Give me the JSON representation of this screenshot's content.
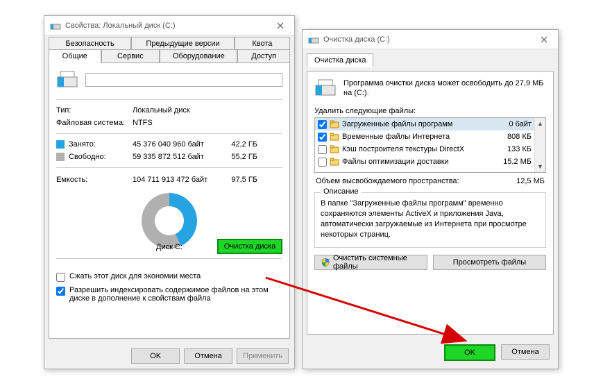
{
  "props": {
    "title": "Свойства: Локальный диск (C:)",
    "tabs_top": [
      "Безопасность",
      "Предыдущие версии",
      "Квота"
    ],
    "tabs_bot": [
      "Общие",
      "Сервис",
      "Оборудование",
      "Доступ"
    ],
    "name_value": "",
    "type_label": "Тип:",
    "type_value": "Локальный диск",
    "fs_label": "Файловая система:",
    "fs_value": "NTFS",
    "used_label": "Занято:",
    "used_bytes": "45 376 040 960 байт",
    "used_gb": "42,2 ГБ",
    "free_label": "Свободно:",
    "free_bytes": "59 335 872 512 байт",
    "free_gb": "55,2 ГБ",
    "cap_label": "Емкость:",
    "cap_bytes": "104 711 913 472 байт",
    "cap_gb": "97,5 ГБ",
    "disk_label": "Диск C:",
    "clean_btn": "Очистка диска",
    "compress_label": "Сжать этот диск для экономии места",
    "index_label": "Разрешить индексировать содержимое файлов на этом диске в дополнение к свойствам файла",
    "ok": "OK",
    "cancel": "Отмена",
    "apply": "Применить"
  },
  "cleanup": {
    "title": "Очистка диска  (C:)",
    "tab": "Очистка диска",
    "intro": "Программа очистки диска может освободить до 27,9 МБ на  (C:).",
    "delete_label": "Удалить следующие файлы:",
    "files": [
      {
        "checked": true,
        "name": "Загруженные файлы программ",
        "size": "0 байт",
        "sel": true
      },
      {
        "checked": true,
        "name": "Временные файлы Интернета",
        "size": "808 КБ",
        "sel": false
      },
      {
        "checked": false,
        "name": "Кэш построителя текстуры DirectX",
        "size": "133 КБ",
        "sel": false
      },
      {
        "checked": false,
        "name": "Файлы оптимизации доставки",
        "size": "15,2 МБ",
        "sel": false
      }
    ],
    "freed_label": "Объем высвобождаемого пространства:",
    "freed_value": "12,5 МБ",
    "desc_title": "Описание",
    "desc_text": "В папке \"Загруженные файлы программ\" временно сохраняются элементы ActiveX и приложения Java, автоматически загружаемые из Интернета при просмотре некоторых страниц.",
    "clean_sys": "Очистить системные файлы",
    "view_files": "Просмотреть файлы",
    "ok": "OK",
    "cancel": "Отмена"
  }
}
